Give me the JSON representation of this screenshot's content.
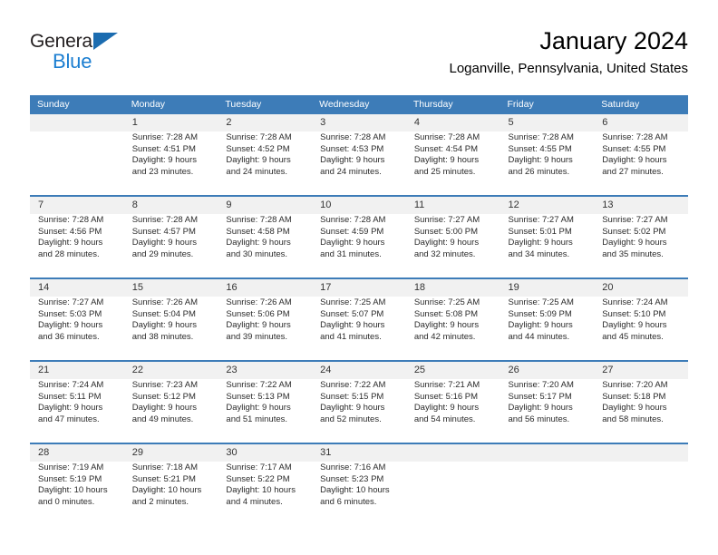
{
  "brand": {
    "name_part1": "General",
    "name_part2": "Blue",
    "accent_color": "#1b7ed1",
    "triangle_color": "#1b6cb0"
  },
  "header": {
    "title": "January 2024",
    "subtitle": "Loganville, Pennsylvania, United States"
  },
  "calendar": {
    "header_bg": "#3d7cb8",
    "row_band_bg": "#f1f1f1",
    "weekdays": [
      "Sunday",
      "Monday",
      "Tuesday",
      "Wednesday",
      "Thursday",
      "Friday",
      "Saturday"
    ],
    "weeks": [
      [
        {
          "day": "",
          "sunrise": "",
          "sunset": "",
          "daylight_line1": "",
          "daylight_line2": ""
        },
        {
          "day": "1",
          "sunrise": "Sunrise: 7:28 AM",
          "sunset": "Sunset: 4:51 PM",
          "daylight_line1": "Daylight: 9 hours",
          "daylight_line2": "and 23 minutes."
        },
        {
          "day": "2",
          "sunrise": "Sunrise: 7:28 AM",
          "sunset": "Sunset: 4:52 PM",
          "daylight_line1": "Daylight: 9 hours",
          "daylight_line2": "and 24 minutes."
        },
        {
          "day": "3",
          "sunrise": "Sunrise: 7:28 AM",
          "sunset": "Sunset: 4:53 PM",
          "daylight_line1": "Daylight: 9 hours",
          "daylight_line2": "and 24 minutes."
        },
        {
          "day": "4",
          "sunrise": "Sunrise: 7:28 AM",
          "sunset": "Sunset: 4:54 PM",
          "daylight_line1": "Daylight: 9 hours",
          "daylight_line2": "and 25 minutes."
        },
        {
          "day": "5",
          "sunrise": "Sunrise: 7:28 AM",
          "sunset": "Sunset: 4:55 PM",
          "daylight_line1": "Daylight: 9 hours",
          "daylight_line2": "and 26 minutes."
        },
        {
          "day": "6",
          "sunrise": "Sunrise: 7:28 AM",
          "sunset": "Sunset: 4:55 PM",
          "daylight_line1": "Daylight: 9 hours",
          "daylight_line2": "and 27 minutes."
        }
      ],
      [
        {
          "day": "7",
          "sunrise": "Sunrise: 7:28 AM",
          "sunset": "Sunset: 4:56 PM",
          "daylight_line1": "Daylight: 9 hours",
          "daylight_line2": "and 28 minutes."
        },
        {
          "day": "8",
          "sunrise": "Sunrise: 7:28 AM",
          "sunset": "Sunset: 4:57 PM",
          "daylight_line1": "Daylight: 9 hours",
          "daylight_line2": "and 29 minutes."
        },
        {
          "day": "9",
          "sunrise": "Sunrise: 7:28 AM",
          "sunset": "Sunset: 4:58 PM",
          "daylight_line1": "Daylight: 9 hours",
          "daylight_line2": "and 30 minutes."
        },
        {
          "day": "10",
          "sunrise": "Sunrise: 7:28 AM",
          "sunset": "Sunset: 4:59 PM",
          "daylight_line1": "Daylight: 9 hours",
          "daylight_line2": "and 31 minutes."
        },
        {
          "day": "11",
          "sunrise": "Sunrise: 7:27 AM",
          "sunset": "Sunset: 5:00 PM",
          "daylight_line1": "Daylight: 9 hours",
          "daylight_line2": "and 32 minutes."
        },
        {
          "day": "12",
          "sunrise": "Sunrise: 7:27 AM",
          "sunset": "Sunset: 5:01 PM",
          "daylight_line1": "Daylight: 9 hours",
          "daylight_line2": "and 34 minutes."
        },
        {
          "day": "13",
          "sunrise": "Sunrise: 7:27 AM",
          "sunset": "Sunset: 5:02 PM",
          "daylight_line1": "Daylight: 9 hours",
          "daylight_line2": "and 35 minutes."
        }
      ],
      [
        {
          "day": "14",
          "sunrise": "Sunrise: 7:27 AM",
          "sunset": "Sunset: 5:03 PM",
          "daylight_line1": "Daylight: 9 hours",
          "daylight_line2": "and 36 minutes."
        },
        {
          "day": "15",
          "sunrise": "Sunrise: 7:26 AM",
          "sunset": "Sunset: 5:04 PM",
          "daylight_line1": "Daylight: 9 hours",
          "daylight_line2": "and 38 minutes."
        },
        {
          "day": "16",
          "sunrise": "Sunrise: 7:26 AM",
          "sunset": "Sunset: 5:06 PM",
          "daylight_line1": "Daylight: 9 hours",
          "daylight_line2": "and 39 minutes."
        },
        {
          "day": "17",
          "sunrise": "Sunrise: 7:25 AM",
          "sunset": "Sunset: 5:07 PM",
          "daylight_line1": "Daylight: 9 hours",
          "daylight_line2": "and 41 minutes."
        },
        {
          "day": "18",
          "sunrise": "Sunrise: 7:25 AM",
          "sunset": "Sunset: 5:08 PM",
          "daylight_line1": "Daylight: 9 hours",
          "daylight_line2": "and 42 minutes."
        },
        {
          "day": "19",
          "sunrise": "Sunrise: 7:25 AM",
          "sunset": "Sunset: 5:09 PM",
          "daylight_line1": "Daylight: 9 hours",
          "daylight_line2": "and 44 minutes."
        },
        {
          "day": "20",
          "sunrise": "Sunrise: 7:24 AM",
          "sunset": "Sunset: 5:10 PM",
          "daylight_line1": "Daylight: 9 hours",
          "daylight_line2": "and 45 minutes."
        }
      ],
      [
        {
          "day": "21",
          "sunrise": "Sunrise: 7:24 AM",
          "sunset": "Sunset: 5:11 PM",
          "daylight_line1": "Daylight: 9 hours",
          "daylight_line2": "and 47 minutes."
        },
        {
          "day": "22",
          "sunrise": "Sunrise: 7:23 AM",
          "sunset": "Sunset: 5:12 PM",
          "daylight_line1": "Daylight: 9 hours",
          "daylight_line2": "and 49 minutes."
        },
        {
          "day": "23",
          "sunrise": "Sunrise: 7:22 AM",
          "sunset": "Sunset: 5:13 PM",
          "daylight_line1": "Daylight: 9 hours",
          "daylight_line2": "and 51 minutes."
        },
        {
          "day": "24",
          "sunrise": "Sunrise: 7:22 AM",
          "sunset": "Sunset: 5:15 PM",
          "daylight_line1": "Daylight: 9 hours",
          "daylight_line2": "and 52 minutes."
        },
        {
          "day": "25",
          "sunrise": "Sunrise: 7:21 AM",
          "sunset": "Sunset: 5:16 PM",
          "daylight_line1": "Daylight: 9 hours",
          "daylight_line2": "and 54 minutes."
        },
        {
          "day": "26",
          "sunrise": "Sunrise: 7:20 AM",
          "sunset": "Sunset: 5:17 PM",
          "daylight_line1": "Daylight: 9 hours",
          "daylight_line2": "and 56 minutes."
        },
        {
          "day": "27",
          "sunrise": "Sunrise: 7:20 AM",
          "sunset": "Sunset: 5:18 PM",
          "daylight_line1": "Daylight: 9 hours",
          "daylight_line2": "and 58 minutes."
        }
      ],
      [
        {
          "day": "28",
          "sunrise": "Sunrise: 7:19 AM",
          "sunset": "Sunset: 5:19 PM",
          "daylight_line1": "Daylight: 10 hours",
          "daylight_line2": "and 0 minutes."
        },
        {
          "day": "29",
          "sunrise": "Sunrise: 7:18 AM",
          "sunset": "Sunset: 5:21 PM",
          "daylight_line1": "Daylight: 10 hours",
          "daylight_line2": "and 2 minutes."
        },
        {
          "day": "30",
          "sunrise": "Sunrise: 7:17 AM",
          "sunset": "Sunset: 5:22 PM",
          "daylight_line1": "Daylight: 10 hours",
          "daylight_line2": "and 4 minutes."
        },
        {
          "day": "31",
          "sunrise": "Sunrise: 7:16 AM",
          "sunset": "Sunset: 5:23 PM",
          "daylight_line1": "Daylight: 10 hours",
          "daylight_line2": "and 6 minutes."
        },
        {
          "day": "",
          "sunrise": "",
          "sunset": "",
          "daylight_line1": "",
          "daylight_line2": ""
        },
        {
          "day": "",
          "sunrise": "",
          "sunset": "",
          "daylight_line1": "",
          "daylight_line2": ""
        },
        {
          "day": "",
          "sunrise": "",
          "sunset": "",
          "daylight_line1": "",
          "daylight_line2": ""
        }
      ]
    ]
  }
}
